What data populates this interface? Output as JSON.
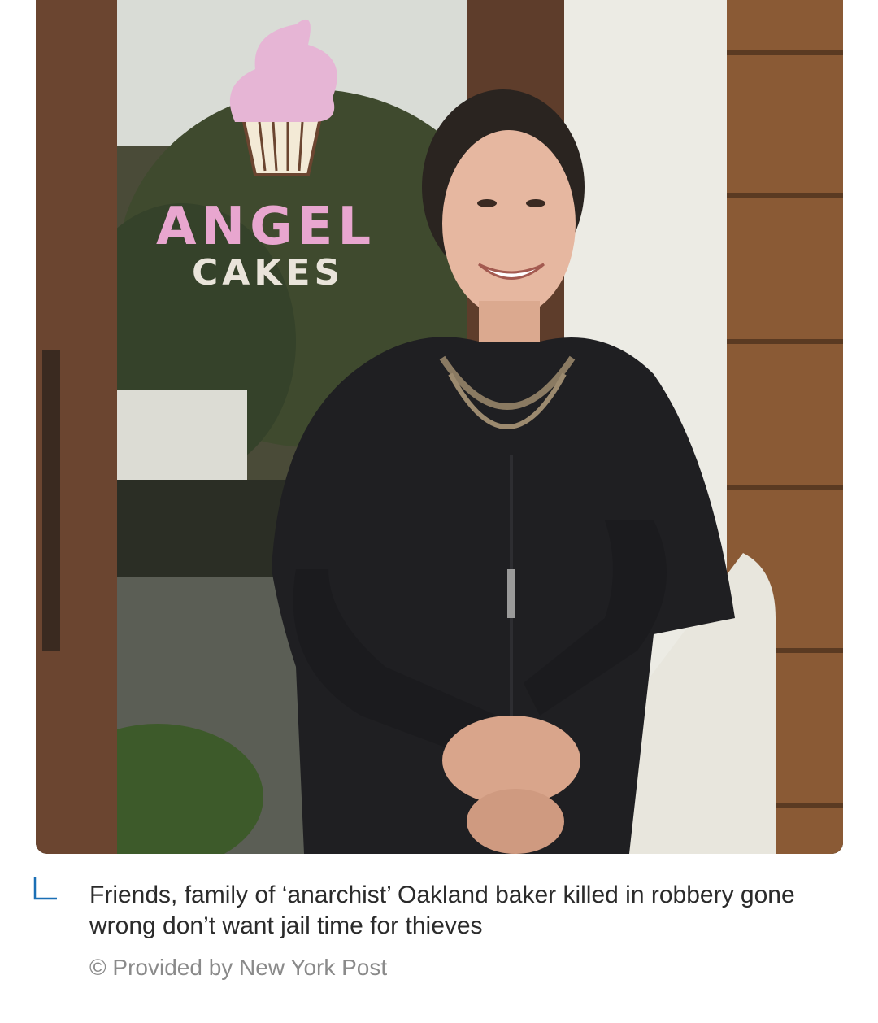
{
  "image": {
    "sign": {
      "line1": "ANGEL",
      "line2": "CAKES"
    }
  },
  "caption": {
    "title": "Friends, family of ‘anarchist’ Oakland baker killed in robbery gone wrong don’t want jail time for thieves",
    "credit": "© Provided by New York Post",
    "accent_color": "#1a6fb5"
  }
}
